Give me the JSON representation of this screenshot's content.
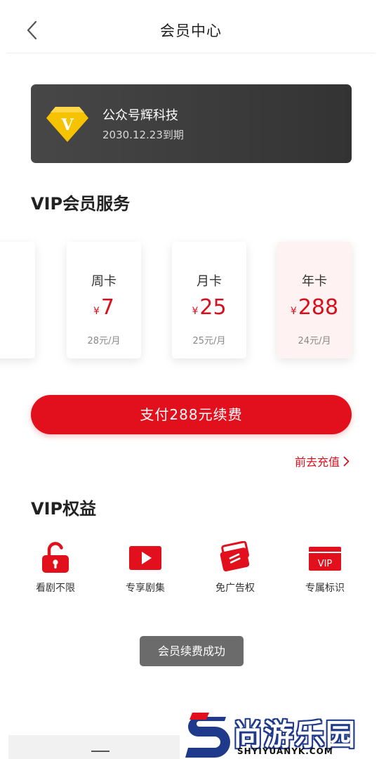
{
  "header": {
    "title": "会员中心",
    "back_icon": "chevron-left-icon"
  },
  "member": {
    "badge_letter": "V",
    "name": "公众号辉科技",
    "expire": "2030.12.23到期",
    "colors": {
      "card": "#3a3a3a",
      "badge": "#f6c300"
    }
  },
  "services": {
    "title": "VIP会员服务",
    "currency": "¥",
    "plans": [
      {
        "name": "周卡",
        "price": "7",
        "unit": "28元/月"
      },
      {
        "name": "月卡",
        "price": "25",
        "unit": "25元/月"
      },
      {
        "name": "年卡",
        "price": "288",
        "unit": "24元/月",
        "selected": true
      }
    ]
  },
  "pay_button": {
    "label": "支付288元续费"
  },
  "recharge": {
    "label": "前去充值",
    "icon": "chevron-right-icon"
  },
  "rights": {
    "title": "VIP权益",
    "items": [
      {
        "label": "看剧不限",
        "icon": "unlock-icon"
      },
      {
        "label": "专享剧集",
        "icon": "play-icon"
      },
      {
        "label": "免广告权",
        "icon": "ad-free-card-icon"
      },
      {
        "label": "专属标识",
        "icon": "vip-badge-icon"
      }
    ],
    "vip_badge_text": "VIP"
  },
  "toast": {
    "message": "会员续费成功"
  },
  "watermark": {
    "title": "尚游乐园",
    "domain": "SHYIYUANYK.COM"
  },
  "colors": {
    "accent": "#e1101c",
    "price": "#d8101b",
    "selected_plan_bg": "#fff2f2"
  }
}
